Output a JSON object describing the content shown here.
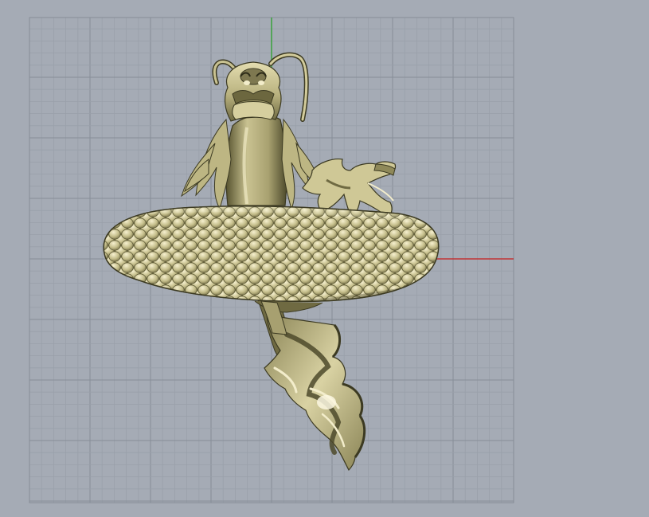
{
  "viewport": {
    "view_name": "",
    "background_color": "#a5abb5",
    "grid_minor_color": "#99a0aa",
    "grid_major_color": "#878e98",
    "x_axis_color": "#c81e1e",
    "y_axis_color": "#1fa01f",
    "grid_visible": true,
    "axes_visible": true
  },
  "model": {
    "object_name": "",
    "object_icon": "dragon-model-icon",
    "shading": "shaded",
    "base_color": "#c9c291",
    "highlight_color": "#f2eccb",
    "shadow_color": "#4d4a2c"
  }
}
